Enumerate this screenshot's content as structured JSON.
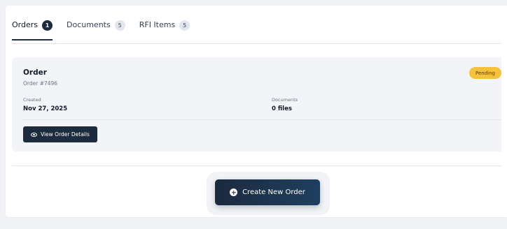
{
  "tabs": [
    {
      "label": "Orders",
      "count": "1",
      "active": true
    },
    {
      "label": "Documents",
      "count": "5",
      "active": false
    },
    {
      "label": "RFI Items",
      "count": "5",
      "active": false
    }
  ],
  "order": {
    "title": "Order",
    "number": "Order #7496",
    "status": "Pending",
    "created_label": "Created",
    "created_value": "Nov 27, 2025",
    "documents_label": "Documents",
    "documents_value": "0 files",
    "view_button": "View Order Details"
  },
  "create_button": "Create New Order",
  "colors": {
    "accent": "#1d2b3f",
    "status_pending": "#f6c23e",
    "card_bg": "#f3f4f8"
  },
  "icons": {
    "view": "eye-icon",
    "create": "plus-circle-icon"
  }
}
